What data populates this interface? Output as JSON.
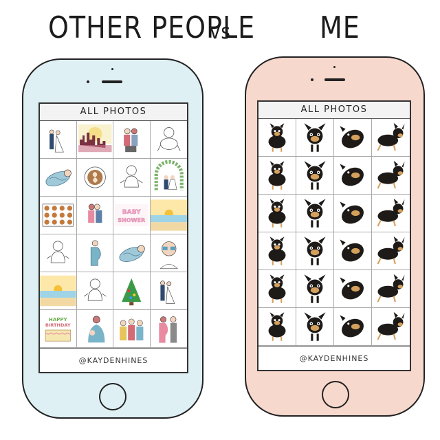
{
  "titles": {
    "left": "OTHER PEOPLE",
    "vs": "vs",
    "right": "ME"
  },
  "left_phone": {
    "header": "ALL PHOTOS",
    "credit": "@KAYDENHINES",
    "photos": [
      {
        "subject": "wedding-couple"
      },
      {
        "subject": "city-skyline"
      },
      {
        "subject": "couple-hug"
      },
      {
        "subject": "baby-crawling"
      },
      {
        "subject": "swaddled-baby"
      },
      {
        "subject": "latte-art"
      },
      {
        "subject": "baby-sitting"
      },
      {
        "subject": "wedding-arch"
      },
      {
        "subject": "cookies-tray"
      },
      {
        "subject": "couple-kiss"
      },
      {
        "subject": "baby-shower-sign",
        "text": "BABY SHOWER"
      },
      {
        "subject": "beach-sunset"
      },
      {
        "subject": "baby-sitting"
      },
      {
        "subject": "pregnant-woman"
      },
      {
        "subject": "swaddled-baby"
      },
      {
        "subject": "woman-sunglasses"
      },
      {
        "subject": "beach-sunset"
      },
      {
        "subject": "baby-sitting"
      },
      {
        "subject": "christmas-tree"
      },
      {
        "subject": "wedding-couple"
      },
      {
        "subject": "birthday-cake",
        "text": "HAPPY BIRTHDAY"
      },
      {
        "subject": "mother-baby"
      },
      {
        "subject": "group-selfie"
      },
      {
        "subject": "pregnant-couple"
      }
    ],
    "colors": {
      "body": "#dff0f4"
    }
  },
  "right_phone": {
    "header": "ALL PHOTOS",
    "credit": "@KAYDENHINES",
    "photo_count": 24,
    "photo_subject": "chihuahua-dog",
    "colors": {
      "body": "#f7d8cd"
    }
  }
}
